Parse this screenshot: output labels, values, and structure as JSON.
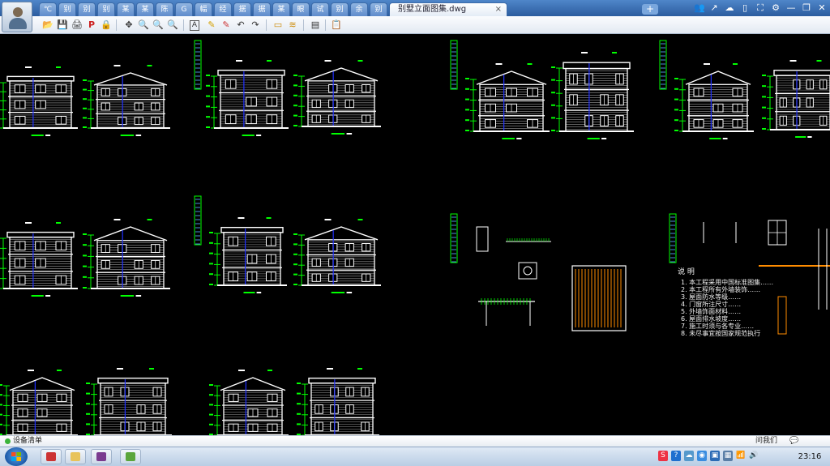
{
  "window": {
    "tabs": [
      "℃",
      "别",
      "别",
      "别",
      "某",
      "某",
      "陈",
      "G",
      "幅",
      "经",
      "据",
      "据",
      "某",
      "眼",
      "试",
      "别",
      "余",
      "别"
    ],
    "active_tab": "别墅立面图集.dwg",
    "active_tab_close": "×",
    "new_tab": "+",
    "controls": [
      "👥",
      "↗",
      "☁",
      "▯",
      "⛶",
      "⚙",
      "—",
      "❐",
      "✕"
    ]
  },
  "toolbar": {
    "icons": [
      "📂",
      "💾",
      "🖨",
      "P",
      "🔒",
      "✥",
      "🔍",
      "🔍",
      "🔍",
      "A",
      "✎",
      "✎",
      "↶",
      "↷",
      "▭",
      "≋",
      "▤",
      "📋"
    ]
  },
  "drawing": {
    "notes_title": "说 明",
    "notes": [
      "1. 本工程采用中国标准图集……",
      "2. 本工程所有外墙装饰……",
      "3. 屋面防水等级……",
      "4. 门窗所注尺寸……",
      "5. 外墙饰面材料……",
      "6. 屋面排水坡度……",
      "7. 施工时须与各专业……",
      "8. 未尽事宜按国家规范执行"
    ]
  },
  "statusbar": {
    "text": "设备清单",
    "right_text": "问我们",
    "chat_icon": "💬"
  },
  "taskbar": {
    "time": "23:16",
    "tray": [
      "S",
      "?",
      "☁",
      "◉",
      "▣",
      "▦",
      "📶",
      "🔊"
    ]
  },
  "colors": {
    "titlebar": "#3a6db0",
    "canvas": "#000000",
    "linework": "#ffffff",
    "dimension": "#00ff00",
    "section": "#2030ff",
    "hatch": "#ff8c00",
    "accent": "#4a90d9"
  }
}
